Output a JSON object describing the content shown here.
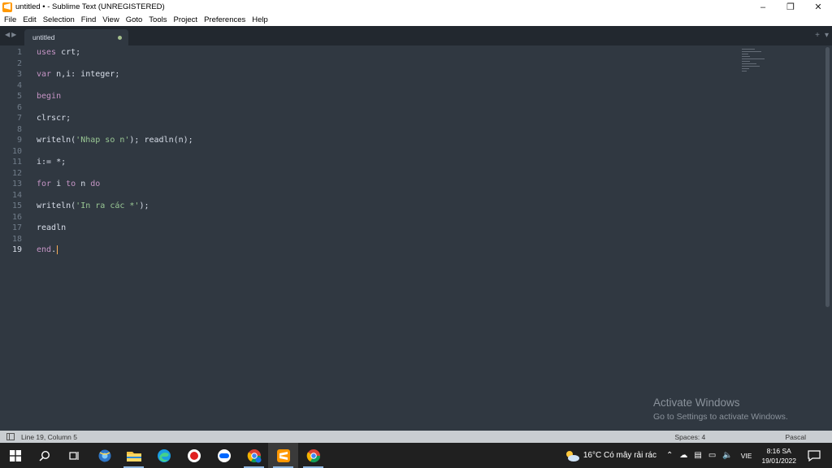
{
  "window": {
    "title": "untitled • - Sublime Text (UNREGISTERED)",
    "controls": {
      "minimize": "–",
      "maximize": "❐",
      "close": "✕"
    }
  },
  "menu": [
    "File",
    "Edit",
    "Selection",
    "Find",
    "View",
    "Goto",
    "Tools",
    "Project",
    "Preferences",
    "Help"
  ],
  "tabs": [
    {
      "label": "untitled",
      "modified": true
    }
  ],
  "editor": {
    "active_line": 19,
    "lines": [
      "uses crt;",
      "",
      "var n,i: integer;",
      "",
      "begin",
      "",
      "clrscr;",
      "",
      "writeln('Nhap so n'); readln(n);",
      "",
      "i:= *;",
      "",
      "for i to n do",
      "",
      "writeln('In ra các *');",
      "",
      "readln",
      "",
      "end."
    ]
  },
  "watermark": {
    "line1": "Activate Windows",
    "line2": "Go to Settings to activate Windows."
  },
  "status": {
    "position": "Line 19, Column 5",
    "spaces": "Spaces: 4",
    "syntax": "Pascal"
  },
  "taskbar": {
    "weather": "16°C  Có mây rải rác",
    "language": "VIE",
    "time": "8:16 SA",
    "date": "19/01/2022"
  },
  "colors": {
    "editor_bg": "#303841",
    "keyword": "#c594c5",
    "string": "#99c794",
    "caret": "#f9ae58"
  }
}
